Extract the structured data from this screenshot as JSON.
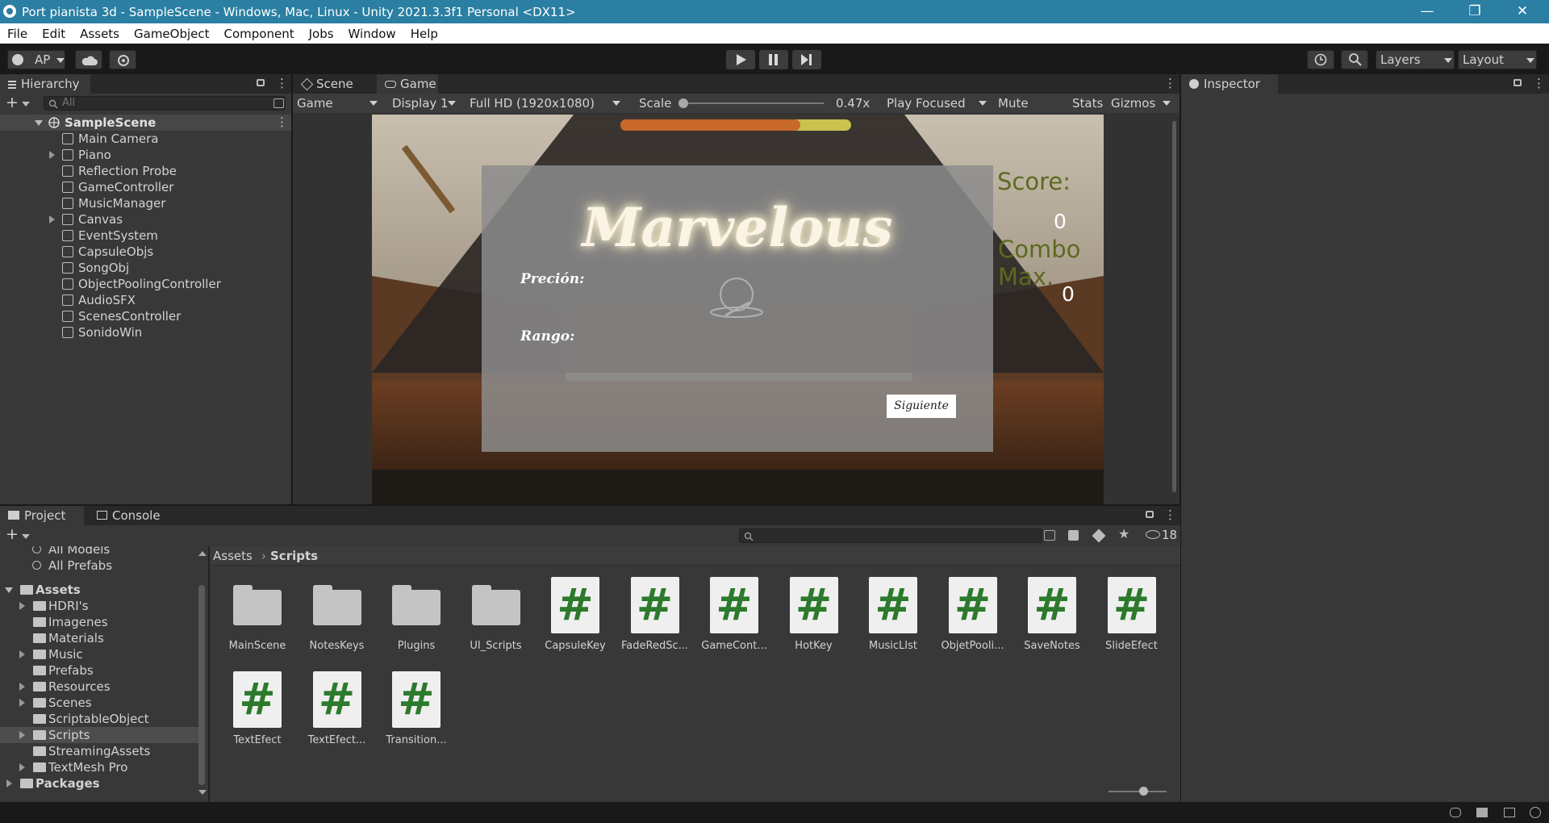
{
  "window": {
    "title": "Port pianista 3d - SampleScene - Windows, Mac, Linux - Unity 2021.3.3f1 Personal <DX11>",
    "controls": [
      "—",
      "❐",
      "✕"
    ]
  },
  "menu": [
    "File",
    "Edit",
    "Assets",
    "GameObject",
    "Component",
    "Jobs",
    "Window",
    "Help"
  ],
  "toolbar": {
    "account": "AP",
    "layers": "Layers",
    "layout": "Layout"
  },
  "hierarchy": {
    "tab": "Hierarchy",
    "search_placeholder": "All",
    "scene": "SampleScene",
    "items": [
      {
        "label": "Main Camera",
        "expandable": false
      },
      {
        "label": "Piano",
        "expandable": true
      },
      {
        "label": "Reflection Probe",
        "expandable": false
      },
      {
        "label": "GameController",
        "expandable": false
      },
      {
        "label": "MusicManager",
        "expandable": false
      },
      {
        "label": "Canvas",
        "expandable": true
      },
      {
        "label": "EventSystem",
        "expandable": false
      },
      {
        "label": "CapsuleObjs",
        "expandable": false
      },
      {
        "label": "SongObj",
        "expandable": false
      },
      {
        "label": "ObjectPoolingController",
        "expandable": false
      },
      {
        "label": "AudioSFX",
        "expandable": false
      },
      {
        "label": "ScenesController",
        "expandable": false
      },
      {
        "label": "SonidoWin",
        "expandable": false
      }
    ]
  },
  "center_tabs": {
    "scene": "Scene",
    "game": "Game"
  },
  "game_toolbar": {
    "view": "Game",
    "display": "Display 1",
    "resolution": "Full HD (1920x1080)",
    "scale_label": "Scale",
    "scale_value": "0.47x",
    "play_mode": "Play Focused",
    "mute": "Mute Audio",
    "stats": "Stats",
    "gizmos": "Gizmos"
  },
  "game_view": {
    "progress": 0.78,
    "result_title": "Marvelous",
    "precision_label": "Preción:",
    "rank_label": "Rango:",
    "next_button": "Siguiente",
    "score_label": "Score:",
    "score_value": "0",
    "combo_label": "Combo",
    "combo_label2": "Max.",
    "combo_value": "0"
  },
  "inspector": {
    "tab": "Inspector"
  },
  "project": {
    "tab_project": "Project",
    "tab_console": "Console",
    "hidden_count": "18",
    "breadcrumb": [
      "Assets",
      "Scripts"
    ],
    "favorites": [
      "All Models",
      "All Prefabs"
    ],
    "tree": [
      {
        "label": "Assets",
        "bold": true,
        "level": 0,
        "expandable": true,
        "open": true
      },
      {
        "label": "HDRI's",
        "level": 1,
        "expandable": true
      },
      {
        "label": "Imagenes",
        "level": 1,
        "expandable": false
      },
      {
        "label": "Materials",
        "level": 1,
        "expandable": false
      },
      {
        "label": "Music",
        "level": 1,
        "expandable": true
      },
      {
        "label": "Prefabs",
        "level": 1,
        "expandable": false
      },
      {
        "label": "Resources",
        "level": 1,
        "expandable": true
      },
      {
        "label": "Scenes",
        "level": 1,
        "expandable": true
      },
      {
        "label": "ScriptableObject",
        "level": 1,
        "expandable": false
      },
      {
        "label": "Scripts",
        "level": 1,
        "expandable": true,
        "selected": true
      },
      {
        "label": "StreamingAssets",
        "level": 1,
        "expandable": false
      },
      {
        "label": "TextMesh Pro",
        "level": 1,
        "expandable": true
      },
      {
        "label": "Packages",
        "bold": true,
        "level": 0,
        "expandable": true
      }
    ],
    "assets": [
      {
        "label": "MainScene",
        "kind": "folder"
      },
      {
        "label": "NotesKeys",
        "kind": "folder"
      },
      {
        "label": "Plugins",
        "kind": "folder"
      },
      {
        "label": "UI_Scripts",
        "kind": "folder"
      },
      {
        "label": "CapsuleKey",
        "kind": "script"
      },
      {
        "label": "FadeRedSc...",
        "kind": "script"
      },
      {
        "label": "GameCont...",
        "kind": "script"
      },
      {
        "label": "HotKey",
        "kind": "script"
      },
      {
        "label": "MusicLIst",
        "kind": "script"
      },
      {
        "label": "ObjetPooli...",
        "kind": "script"
      },
      {
        "label": "SaveNotes",
        "kind": "script"
      },
      {
        "label": "SlideEfect",
        "kind": "script"
      },
      {
        "label": "TextEfect",
        "kind": "script"
      },
      {
        "label": "TextEfect...",
        "kind": "script"
      },
      {
        "label": "Transition...",
        "kind": "script"
      }
    ]
  }
}
